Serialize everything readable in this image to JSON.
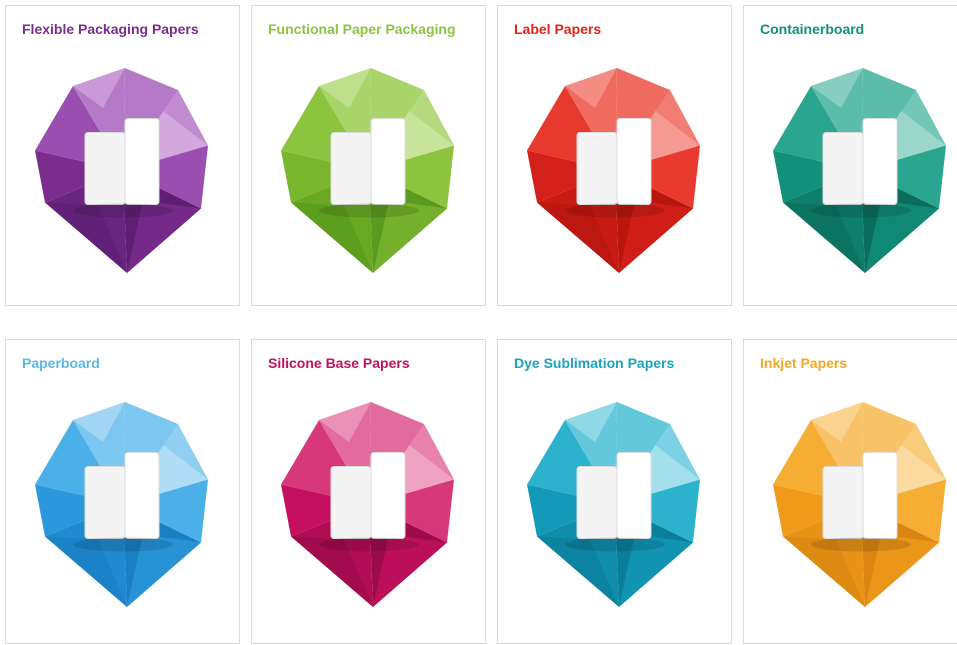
{
  "products": [
    {
      "title": "Flexible Packaging Papers",
      "color": "#7b2d8e",
      "icon": "packaging-pouch-icon",
      "palette": [
        "#5e1f73",
        "#7b2d8e",
        "#9a4fb0",
        "#b57ac7",
        "#d2a8dd",
        "#6a2580"
      ]
    },
    {
      "title": "Functional Paper Packaging",
      "color": "#8dc43f",
      "icon": "paper-bag-icon",
      "palette": [
        "#5a9a1e",
        "#7ab52e",
        "#8dc43f",
        "#a9d46a",
        "#c7e49a",
        "#6aa824"
      ]
    },
    {
      "title": "Label Papers",
      "color": "#e2231a",
      "icon": "label-roll-jar-icon",
      "palette": [
        "#b8160f",
        "#d4201a",
        "#e8392f",
        "#ef6b60",
        "#f59a92",
        "#c81b14"
      ]
    },
    {
      "title": "Containerboard",
      "color": "#12907a",
      "icon": "cardboard-box-icon",
      "palette": [
        "#0b6e5d",
        "#12907a",
        "#2aa58e",
        "#5cbcaa",
        "#9ad6ca",
        "#0e7f6b"
      ]
    },
    {
      "title": "Paperboard",
      "color": "#5bb8e6",
      "icon": "folding-carton-icon",
      "palette": [
        "#1b7fc4",
        "#2a98da",
        "#4bb0e8",
        "#7cc7ef",
        "#b0dcf5",
        "#2189cf"
      ]
    },
    {
      "title": "Silicone Base Papers",
      "color": "#c4105e",
      "icon": "silicone-roll-icon",
      "palette": [
        "#9c0b4a",
        "#c4105e",
        "#d6387a",
        "#e26a9c",
        "#efa3c3",
        "#b00d55"
      ]
    },
    {
      "title": "Dye Sublimation Papers",
      "color": "#1aa3c0",
      "icon": "dress-form-icon",
      "palette": [
        "#0b7f9a",
        "#139ab8",
        "#2cb2cd",
        "#63c8dc",
        "#a2dfeb",
        "#0f8dab"
      ]
    },
    {
      "title": "Inkjet Papers",
      "color": "#f5a623",
      "icon": "printed-poster-icon",
      "palette": [
        "#d98612",
        "#f09a1c",
        "#f5ad33",
        "#f8c366",
        "#fbdaa0",
        "#e69317"
      ]
    }
  ]
}
